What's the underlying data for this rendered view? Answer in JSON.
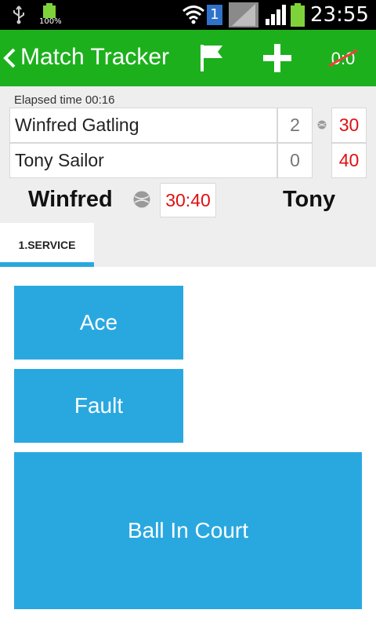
{
  "status_bar": {
    "battery_small_text": "100%",
    "notification_badge": "1",
    "clock": "23:55"
  },
  "app_bar": {
    "title": "Match Tracker",
    "icons": [
      "back-icon",
      "flag-icon",
      "add-icon",
      "reset-score-icon"
    ],
    "reset_label": "0:0",
    "color": "#1db01d"
  },
  "match": {
    "elapsed": "Elapsed time 00:16",
    "players": [
      {
        "name": "Winfred Gatling",
        "games": "2",
        "points": "30",
        "serving": true
      },
      {
        "name": "Tony Sailor",
        "games": "0",
        "points": "40",
        "serving": false
      }
    ],
    "left_short_name": "Winfred",
    "right_short_name": "Tony",
    "game_score": "30:40"
  },
  "tabs": [
    {
      "label": "1.SERVICE",
      "active": true
    }
  ],
  "actions": {
    "ace": "Ace",
    "fault": "Fault",
    "ball_in_court": "Ball In Court",
    "color": "#29a8e0"
  }
}
